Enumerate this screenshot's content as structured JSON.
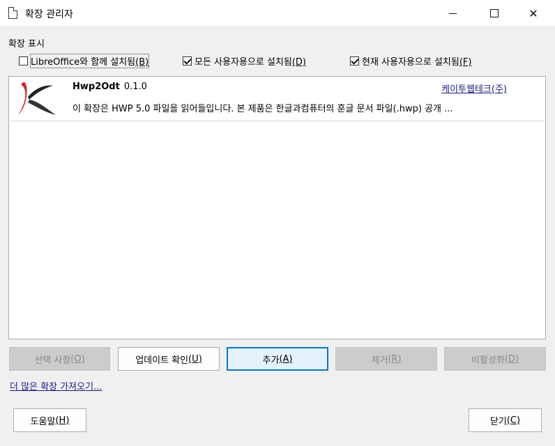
{
  "window": {
    "title": "확장 관리자"
  },
  "filters": {
    "section_label": "확장 표시",
    "items": [
      {
        "label": "LibreOffice와 함께 설치됨",
        "hotkey": "(B)",
        "checked": false
      },
      {
        "label": "모든 사용자용으로 설치됨",
        "hotkey": "(D)",
        "checked": true
      },
      {
        "label": "현재 사용자용으로 설치됨",
        "hotkey": "(F)",
        "checked": true
      }
    ]
  },
  "extensions": [
    {
      "name": "Hwp2Odt",
      "version": "0.1.0",
      "publisher": "케이투웹테크(주)",
      "description": "이 확장은 HWP 5.0 파일을 읽어들입니다. 본 제품은 한글과컴퓨터의 훈글 문서 파일(.hwp) 공개 ...",
      "logo_icon": "k2webtech-logo-icon"
    }
  ],
  "buttons": {
    "options": {
      "label": "선택 사항",
      "hotkey": "(O)"
    },
    "check_updates": {
      "label": "업데이트 확인",
      "hotkey": "(U)"
    },
    "add": {
      "label": "추가",
      "hotkey": "(A)"
    },
    "remove": {
      "label": "제거",
      "hotkey": "(R)"
    },
    "disable": {
      "label": "비활성화",
      "hotkey": "(D)"
    },
    "help": {
      "label": "도움말",
      "hotkey": "(H)"
    },
    "close": {
      "label": "닫기",
      "hotkey": "(C)"
    }
  },
  "more_link": "더 많은 확장 가져오기..."
}
